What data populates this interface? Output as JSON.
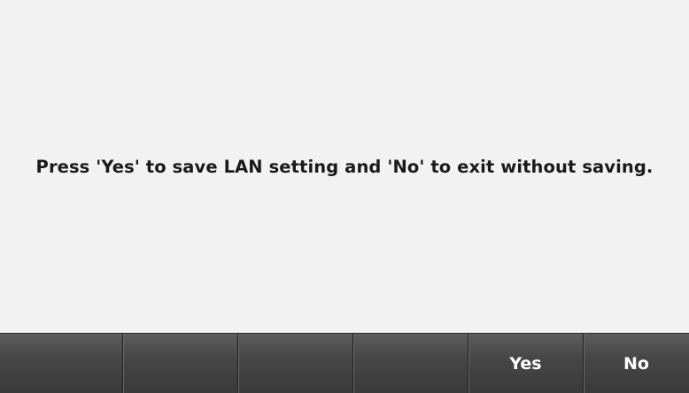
{
  "dialog": {
    "message": "Press 'Yes' to save LAN setting and 'No' to exit without saving."
  },
  "softkeys": [
    {
      "label": ""
    },
    {
      "label": ""
    },
    {
      "label": ""
    },
    {
      "label": ""
    },
    {
      "label": "Yes"
    },
    {
      "label": "No"
    }
  ],
  "colors": {
    "screen_background": "#f2f2f2",
    "softkey_background": "#3a3a3a",
    "softkey_text": "#ffffff",
    "message_text": "#1a1a1a"
  }
}
